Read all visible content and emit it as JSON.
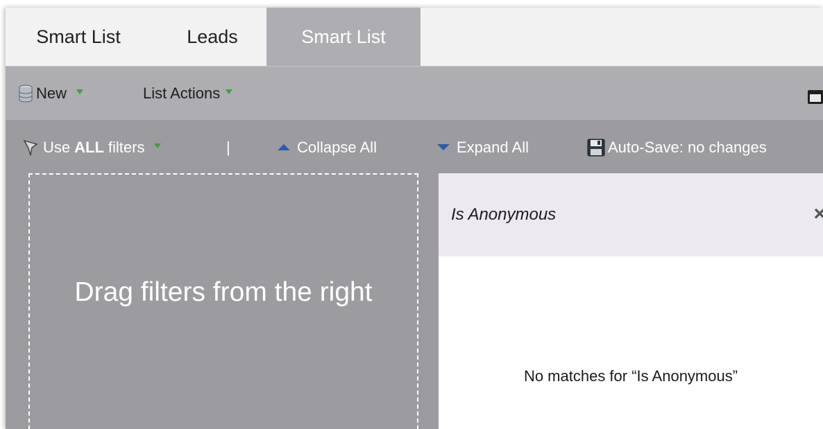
{
  "tabs": [
    {
      "label": "Smart List"
    },
    {
      "label": "Leads"
    },
    {
      "label": "Smart List",
      "active": true
    }
  ],
  "toolbar": {
    "new_label": "New",
    "list_actions_label": "List Actions"
  },
  "filterbar": {
    "use_prefix": "Use",
    "use_bold": "ALL",
    "use_suffix": "filters",
    "separator": "|",
    "collapse_label": "Collapse All",
    "expand_label": "Expand All",
    "autosave_label": "Auto-Save: no changes"
  },
  "canvas": {
    "drop_hint": "Drag filters from the right"
  },
  "filter_panel": {
    "search_value": "Is Anonymous",
    "close_glyph": "×",
    "no_matches_text": "No matches for “Is Anonymous”"
  },
  "colors": {
    "panel_bg": "#9c9ba0",
    "toolbar_bg": "#aeadb2",
    "active_tab_bg": "#aeadb2",
    "accent_blue": "#2a5db0",
    "caret_green": "#3aa33a"
  },
  "icons": [
    "database-icon",
    "caret-down-green-icon",
    "filter-funnel-icon",
    "triangle-up-icon",
    "triangle-down-icon",
    "floppy-save-icon",
    "window-icon",
    "close-icon"
  ]
}
